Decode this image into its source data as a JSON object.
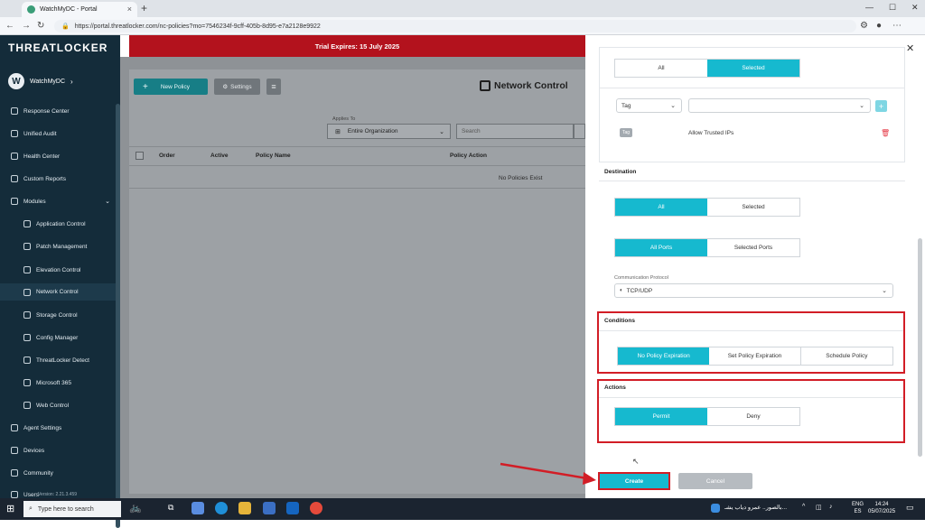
{
  "browser": {
    "tab_title": "WatchMyDC - Portal",
    "url": "https://portal.threatlocker.com/nc-policies?mo=7546234f-9cff-405b-8d95-e7a2128e9922"
  },
  "sidebar": {
    "logo": "THREATLOCKER",
    "org_initial": "W",
    "org_name": "WatchMyDC",
    "items": [
      {
        "label": "Response Center"
      },
      {
        "label": "Unified Audit"
      },
      {
        "label": "Health Center"
      },
      {
        "label": "Custom Reports"
      },
      {
        "label": "Modules"
      },
      {
        "label": "Application Control"
      },
      {
        "label": "Patch Management"
      },
      {
        "label": "Elevation Control"
      },
      {
        "label": "Network Control"
      },
      {
        "label": "Storage Control"
      },
      {
        "label": "Config Manager"
      },
      {
        "label": "ThreatLocker Detect"
      },
      {
        "label": "Microsoft 365"
      },
      {
        "label": "Web Control"
      },
      {
        "label": "Agent Settings"
      },
      {
        "label": "Devices"
      },
      {
        "label": "Community"
      },
      {
        "label": "Users"
      }
    ],
    "version": "Version: 2.21.3.459"
  },
  "banner": "Trial Expires: 15 July 2025",
  "toolbar": {
    "new_policy": "New Policy",
    "settings": "Settings",
    "page_title": "Network Control"
  },
  "filters": {
    "applies_to_label": "Applies To",
    "applies_to_value": "Entire Organization",
    "search_placeholder": "Search"
  },
  "table": {
    "headers": [
      "Order",
      "Active",
      "Policy Name",
      "Policy Action"
    ],
    "empty": "No Policies Exist"
  },
  "drawer": {
    "source_toggle": [
      "All",
      "Selected"
    ],
    "tag_select": "Tag",
    "tag_chip": "Tag",
    "tag_value": "Allow Trusted IPs",
    "destination": {
      "title": "Destination",
      "toggle": [
        "All",
        "Selected"
      ],
      "ports": [
        "All Ports",
        "Selected Ports"
      ],
      "protocol_label": "Communication Protocol",
      "protocol_value": "TCP/UDP"
    },
    "conditions": {
      "title": "Conditions",
      "options": [
        "No Policy Expiration",
        "Set Policy Expiration",
        "Schedule Policy"
      ]
    },
    "actions": {
      "title": "Actions",
      "options": [
        "Permit",
        "Deny"
      ]
    },
    "create": "Create",
    "cancel": "Cancel"
  },
  "taskbar": {
    "search": "Type here to search",
    "news": "بالصور.. عمرو دياب يشـ...",
    "lang_top": "ENG",
    "lang_bottom": "ES",
    "time": "14:24",
    "date": "05/07/2025"
  },
  "colors": {
    "accent": "#16b9cf",
    "highlight_red": "#d21d26",
    "sidebar_bg": "#142c3a",
    "banner_red": "#b3121d"
  }
}
